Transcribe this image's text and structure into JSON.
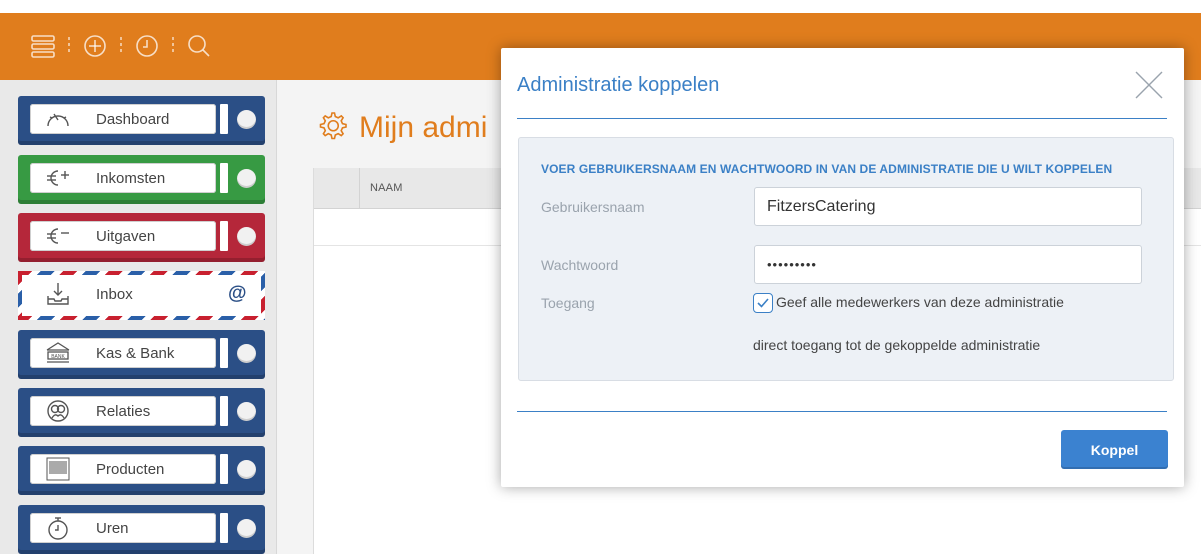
{
  "topbar": {
    "icons": [
      "menu-icon",
      "add-icon",
      "clock-icon",
      "search-icon"
    ],
    "color": "#e07d1d"
  },
  "sidebar": {
    "items": [
      {
        "label": "Dashboard",
        "icon": "speedometer-icon",
        "color": "#2b4f86"
      },
      {
        "label": "Inkomsten",
        "icon": "euro-plus-icon",
        "color": "#379a43"
      },
      {
        "label": "Uitgaven",
        "icon": "euro-minus-icon",
        "color": "#b5273a"
      },
      {
        "label": "Inbox",
        "icon": "inbox-tray-icon",
        "badge": "@"
      },
      {
        "label": "Kas & Bank",
        "icon": "bank-icon",
        "color": "#2b4f86"
      },
      {
        "label": "Relaties",
        "icon": "relations-icon",
        "color": "#2b4f86"
      },
      {
        "label": "Producten",
        "icon": "barcode-icon",
        "color": "#2b4f86"
      },
      {
        "label": "Uren",
        "icon": "stopwatch-icon",
        "color": "#2b4f86"
      }
    ]
  },
  "main": {
    "title": "Mijn admi",
    "table": {
      "columns": [
        "NAAM"
      ]
    }
  },
  "modal": {
    "title": "Administratie koppelen",
    "heading": "VOER GEBRUIKERSNAAM EN WACHTWOORD IN VAN DE ADMINISTRATIE DIE U WILT KOPPELEN",
    "username_label": "Gebruikersnaam",
    "username_value": "FitzersCatering",
    "password_label": "Wachtwoord",
    "password_value": "•••••••••",
    "access_label": "Toegang",
    "access_checked": true,
    "access_text_line1": "Geef alle medewerkers van deze administratie",
    "access_text_line2": "direct toegang tot de gekoppelde administratie",
    "submit_label": "Koppel",
    "accent": "#3b80c6"
  }
}
